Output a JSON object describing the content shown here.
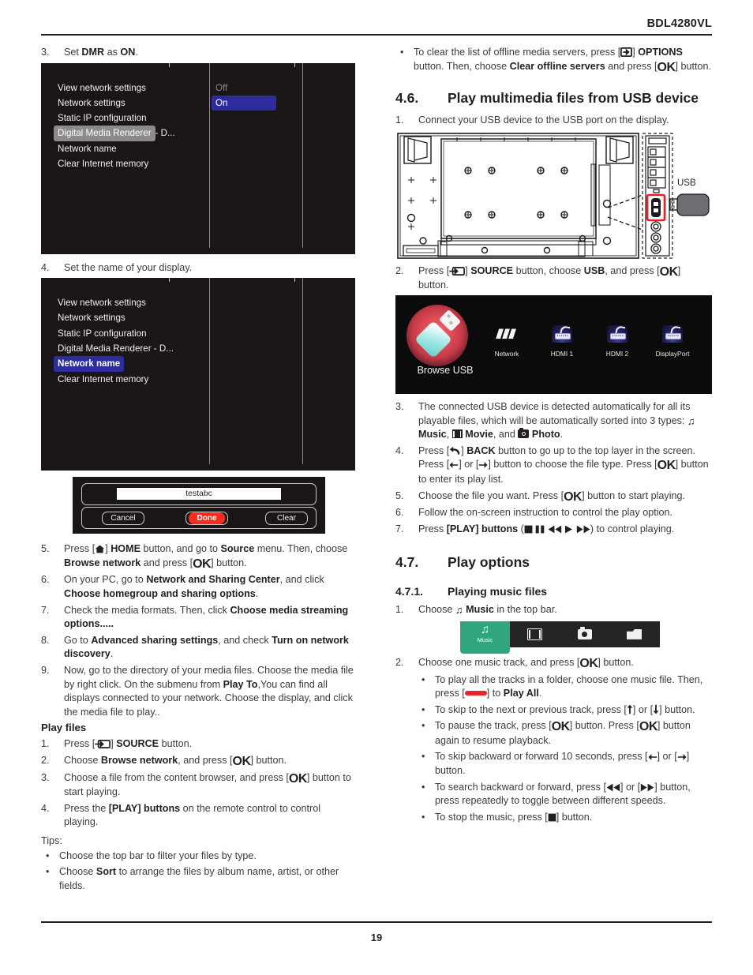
{
  "header": {
    "model": "BDL4280VL"
  },
  "footer": {
    "page_number": "19"
  },
  "left_column": {
    "step3": {
      "num": "3.",
      "pre": "Set ",
      "b1": "DMR",
      "mid": " as ",
      "b2": "ON",
      "post": "."
    },
    "osd1": {
      "items": [
        {
          "label": "View network settings",
          "state": "normal"
        },
        {
          "label": "Network settings",
          "state": "normal"
        },
        {
          "label": "Static IP configuration",
          "state": "normal"
        },
        {
          "label": "Digital Media Renderer - D...",
          "state": "selected-grey",
          "hl_text": "Digital Media Renderer",
          "tail_text": " - D..."
        },
        {
          "label": "Network name",
          "state": "normal"
        },
        {
          "label": "Clear Internet memory",
          "state": "normal"
        }
      ],
      "options": [
        {
          "label": "Off",
          "state": "dim"
        },
        {
          "label": "On",
          "state": "highlighted"
        }
      ]
    },
    "step4": {
      "num": "4.",
      "text": "Set the name of your display."
    },
    "osd2": {
      "items": [
        {
          "label": "View network settings",
          "state": "normal"
        },
        {
          "label": "Network settings",
          "state": "normal"
        },
        {
          "label": "Static IP configuration",
          "state": "normal"
        },
        {
          "label": "Digital Media Renderer - D...",
          "state": "normal"
        },
        {
          "label": "Network name",
          "state": "selected-blue"
        },
        {
          "label": "Clear Internet memory",
          "state": "normal"
        }
      ]
    },
    "keyboard_dialog": {
      "input_value": "testabc",
      "cancel_label": "Cancel",
      "done_label": "Done",
      "clear_label": "Clear",
      "done_color": "#fb2b1f"
    },
    "steps": [
      {
        "num": "5.",
        "parts": [
          {
            "t": "plain",
            "v": "Press  ["
          },
          {
            "t": "icon",
            "v": "home-icon"
          },
          {
            "t": "plain",
            "v": "] "
          },
          {
            "t": "semi",
            "v": "HOME"
          },
          {
            "t": "plain",
            "v": " button, and go to "
          },
          {
            "t": "bold",
            "v": "Source"
          },
          {
            "t": "plain",
            "v": " menu. Then, choose "
          },
          {
            "t": "bold",
            "v": "Browse network"
          },
          {
            "t": "plain",
            "v": " and press ["
          },
          {
            "t": "ok",
            "v": "OK"
          },
          {
            "t": "plain",
            "v": "] button."
          }
        ]
      },
      {
        "num": "6.",
        "parts": [
          {
            "t": "plain",
            "v": "On your PC, go to "
          },
          {
            "t": "bold",
            "v": "Network and Sharing Center"
          },
          {
            "t": "plain",
            "v": ", and click "
          },
          {
            "t": "bold",
            "v": "Choose homegroup and sharing options"
          },
          {
            "t": "plain",
            "v": "."
          }
        ]
      },
      {
        "num": "7.",
        "parts": [
          {
            "t": "plain",
            "v": "Check the media formats. Then, click "
          },
          {
            "t": "bold",
            "v": "Choose media streaming options....."
          }
        ]
      },
      {
        "num": "8.",
        "parts": [
          {
            "t": "plain",
            "v": "Go to "
          },
          {
            "t": "bold",
            "v": "Advanced sharing settings"
          },
          {
            "t": "plain",
            "v": ", and check "
          },
          {
            "t": "bold",
            "v": "Turn on network discovery"
          },
          {
            "t": "plain",
            "v": "."
          }
        ]
      },
      {
        "num": "9.",
        "parts": [
          {
            "t": "plain",
            "v": "Now, go to the directory of your media files. Choose the media file by right click. On the submenu from "
          },
          {
            "t": "bold",
            "v": "Play To"
          },
          {
            "t": "plain",
            "v": ",You can find all displays connected to your network. Choose the display, and click the media file to play.."
          }
        ]
      }
    ],
    "play_files_heading": "Play files",
    "play_files_steps": [
      {
        "num": "1.",
        "parts": [
          {
            "t": "plain",
            "v": "Press ["
          },
          {
            "t": "icon",
            "v": "source-icon"
          },
          {
            "t": "plain",
            "v": "] "
          },
          {
            "t": "semi",
            "v": "SOURCE"
          },
          {
            "t": "plain",
            "v": " button."
          }
        ]
      },
      {
        "num": "2.",
        "parts": [
          {
            "t": "plain",
            "v": "Choose "
          },
          {
            "t": "bold",
            "v": "Browse network"
          },
          {
            "t": "plain",
            "v": ", and press ["
          },
          {
            "t": "ok",
            "v": "OK"
          },
          {
            "t": "plain",
            "v": "] button."
          }
        ]
      },
      {
        "num": "3.",
        "parts": [
          {
            "t": "plain",
            "v": "Choose a file from the content browser, and press ["
          },
          {
            "t": "ok",
            "v": "OK"
          },
          {
            "t": "plain",
            "v": "] button to start playing."
          }
        ]
      },
      {
        "num": "4.",
        "parts": [
          {
            "t": "plain",
            "v": "Press the "
          },
          {
            "t": "bold",
            "v": "[PLAY] buttons"
          },
          {
            "t": "plain",
            "v": " on the remote control to control playing."
          }
        ]
      }
    ],
    "tips_label": "Tips:",
    "tips": [
      {
        "parts": [
          {
            "t": "plain",
            "v": "Choose the top bar to filter your files by type."
          }
        ]
      },
      {
        "parts": [
          {
            "t": "plain",
            "v": "Choose "
          },
          {
            "t": "bold",
            "v": "Sort"
          },
          {
            "t": "plain",
            "v": " to arrange the files by album name, artist, or other fields."
          }
        ]
      }
    ]
  },
  "right_column": {
    "top_bullet": {
      "parts": [
        {
          "t": "plain",
          "v": "To clear the list of offline media servers, press ["
        },
        {
          "t": "icon",
          "v": "options-icon"
        },
        {
          "t": "plain",
          "v": "] "
        },
        {
          "t": "semi",
          "v": "OPTIONS"
        },
        {
          "t": "plain",
          "v": " button. Then, choose "
        },
        {
          "t": "bold",
          "v": "Clear offline servers"
        },
        {
          "t": "plain",
          "v": " and press ["
        },
        {
          "t": "ok",
          "v": "OK"
        },
        {
          "t": "plain",
          "v": "] button."
        }
      ]
    },
    "section46": {
      "number": "4.6.",
      "title": "Play multimedia files from USB device"
    },
    "step1": {
      "num": "1.",
      "text": "Connect your USB device to the USB port on the display."
    },
    "diagram": {
      "usb_label": "USB",
      "highlight_color": "#ee1c25"
    },
    "step2": {
      "num": "2.",
      "parts": [
        {
          "t": "plain",
          "v": "Press ["
        },
        {
          "t": "icon",
          "v": "source-icon"
        },
        {
          "t": "plain",
          "v": "] "
        },
        {
          "t": "semi",
          "v": "SOURCE"
        },
        {
          "t": "plain",
          "v": " button, choose "
        },
        {
          "t": "bold",
          "v": "USB"
        },
        {
          "t": "plain",
          "v": ", and press ["
        },
        {
          "t": "ok",
          "v": "OK"
        },
        {
          "t": "plain",
          "v": "] button."
        }
      ]
    },
    "source_screen": {
      "primary": {
        "label": "Browse USB",
        "icon": "usb-stick-icon"
      },
      "items": [
        {
          "label": "Network",
          "icon": "network-icon"
        },
        {
          "label": "HDMI 1",
          "icon": "hdmi-icon"
        },
        {
          "label": "HDMI 2",
          "icon": "hdmi-icon"
        },
        {
          "label": "DisplayPort",
          "icon": "displayport-icon"
        }
      ]
    },
    "steps": [
      {
        "num": "3.",
        "parts": [
          {
            "t": "plain",
            "v": "The connected USB device is detected automatically for all its playable files, which will be automatically sorted into 3 types: "
          },
          {
            "t": "icon",
            "v": "music-note-icon"
          },
          {
            "t": "bold",
            "v": " Music"
          },
          {
            "t": "plain",
            "v": ", "
          },
          {
            "t": "icon",
            "v": "movie-icon"
          },
          {
            "t": "bold",
            "v": " Movie"
          },
          {
            "t": "plain",
            "v": ", and "
          },
          {
            "t": "icon",
            "v": "photo-icon"
          },
          {
            "t": "bold",
            "v": " Photo"
          },
          {
            "t": "plain",
            "v": "."
          }
        ]
      },
      {
        "num": "4.",
        "parts": [
          {
            "t": "plain",
            "v": "Press ["
          },
          {
            "t": "icon",
            "v": "back-arrow-icon"
          },
          {
            "t": "plain",
            "v": "] "
          },
          {
            "t": "semi",
            "v": "BACK"
          },
          {
            "t": "plain",
            "v": " button to go up to the top layer in the screen. Press ["
          },
          {
            "t": "icon",
            "v": "left-arrow-icon"
          },
          {
            "t": "plain",
            "v": "] or ["
          },
          {
            "t": "icon",
            "v": "right-arrow-icon"
          },
          {
            "t": "plain",
            "v": "] button to choose the file type. Press ["
          },
          {
            "t": "ok",
            "v": "OK"
          },
          {
            "t": "plain",
            "v": "] button to enter its play list."
          }
        ]
      },
      {
        "num": "5.",
        "parts": [
          {
            "t": "plain",
            "v": "Choose the file you want. Press ["
          },
          {
            "t": "ok",
            "v": "OK"
          },
          {
            "t": "plain",
            "v": "] button to start playing."
          }
        ]
      },
      {
        "num": "6.",
        "parts": [
          {
            "t": "plain",
            "v": "Follow the on-screen instruction to control the play option."
          }
        ]
      },
      {
        "num": "7.",
        "parts": [
          {
            "t": "plain",
            "v": "Press "
          },
          {
            "t": "bold",
            "v": "[PLAY] buttons"
          },
          {
            "t": "plain",
            "v": " ("
          },
          {
            "t": "icon",
            "v": "stop-icon"
          },
          {
            "t": "plain",
            "v": "  "
          },
          {
            "t": "icon",
            "v": "pause-icon"
          },
          {
            "t": "plain",
            "v": "  "
          },
          {
            "t": "icon",
            "v": "rewind-icon"
          },
          {
            "t": "plain",
            "v": " "
          },
          {
            "t": "icon",
            "v": "play-icon"
          },
          {
            "t": "plain",
            "v": " "
          },
          {
            "t": "icon",
            "v": "fastforward-icon"
          },
          {
            "t": "plain",
            "v": ") to control playing."
          }
        ]
      }
    ],
    "section47": {
      "number": "4.7.",
      "title": "Play options"
    },
    "section471": {
      "number": "4.7.1.",
      "title": "Playing music files"
    },
    "music_step1": {
      "num": "1.",
      "parts": [
        {
          "t": "plain",
          "v": "Choose "
        },
        {
          "t": "icon",
          "v": "music-note-icon"
        },
        {
          "t": "bold",
          "v": " Music"
        },
        {
          "t": "plain",
          "v": " in the top bar."
        }
      ]
    },
    "topbar": {
      "active_label": "Music",
      "active_color": "#30a57e",
      "tabs": [
        {
          "icon": "music-note-icon",
          "label": "Music",
          "active": true
        },
        {
          "icon": "film-icon",
          "label": "",
          "active": false
        },
        {
          "icon": "camera-icon",
          "label": "",
          "active": false
        },
        {
          "icon": "folder-icon",
          "label": "",
          "active": false
        }
      ]
    },
    "music_step2": {
      "num": "2.",
      "parts": [
        {
          "t": "plain",
          "v": "Choose one music track, and press ["
        },
        {
          "t": "ok",
          "v": "OK"
        },
        {
          "t": "plain",
          "v": "] button."
        }
      ]
    },
    "music_bullets": [
      {
        "parts": [
          {
            "t": "plain",
            "v": "To play all the tracks in a folder, choose one music file. Then, press ["
          },
          {
            "t": "icon",
            "v": "red-key-icon"
          },
          {
            "t": "plain",
            "v": "] to "
          },
          {
            "t": "bold",
            "v": "Play All"
          },
          {
            "t": "plain",
            "v": "."
          }
        ]
      },
      {
        "parts": [
          {
            "t": "plain",
            "v": "To skip to the next or previous track, press ["
          },
          {
            "t": "icon",
            "v": "up-arrow-icon"
          },
          {
            "t": "plain",
            "v": "] or ["
          },
          {
            "t": "icon",
            "v": "down-arrow-icon"
          },
          {
            "t": "plain",
            "v": "] button."
          }
        ]
      },
      {
        "parts": [
          {
            "t": "plain",
            "v": "To pause the track, press ["
          },
          {
            "t": "ok",
            "v": "OK"
          },
          {
            "t": "plain",
            "v": "] button. Press ["
          },
          {
            "t": "ok",
            "v": "OK"
          },
          {
            "t": "plain",
            "v": "] button again to resume playback."
          }
        ]
      },
      {
        "parts": [
          {
            "t": "plain",
            "v": "To skip backward or forward 10 seconds, press ["
          },
          {
            "t": "icon",
            "v": "left-arrow-icon"
          },
          {
            "t": "plain",
            "v": "] or ["
          },
          {
            "t": "icon",
            "v": "right-arrow-icon"
          },
          {
            "t": "plain",
            "v": "] button."
          }
        ]
      },
      {
        "parts": [
          {
            "t": "plain",
            "v": "To search backward or forward, press ["
          },
          {
            "t": "icon",
            "v": "rewind-icon"
          },
          {
            "t": "plain",
            "v": "] or ["
          },
          {
            "t": "icon",
            "v": "fastforward-icon"
          },
          {
            "t": "plain",
            "v": "] button, press repeatedly to toggle between different speeds."
          }
        ]
      },
      {
        "parts": [
          {
            "t": "plain",
            "v": "To stop the music, press ["
          },
          {
            "t": "icon",
            "v": "stop-icon"
          },
          {
            "t": "plain",
            "v": "] button."
          }
        ]
      }
    ]
  }
}
